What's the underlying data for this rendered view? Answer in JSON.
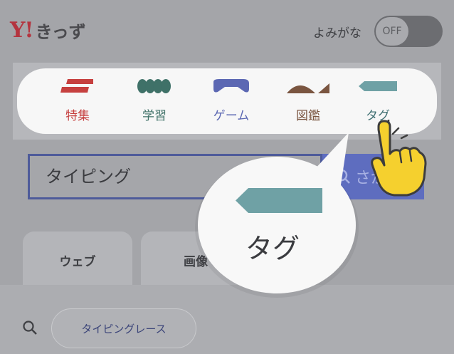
{
  "header": {
    "logo_mark": "Y!",
    "logo_text": "きっず",
    "yomigana_label": "よみがな",
    "yomigana_state": "OFF"
  },
  "menu": {
    "items": [
      {
        "label": "特集",
        "color": "#c6403f",
        "icon": "feature-stripes-icon"
      },
      {
        "label": "学習",
        "color": "#3f7168",
        "icon": "learning-beads-icon"
      },
      {
        "label": "ゲーム",
        "color": "#5c68b3",
        "icon": "game-controller-icon"
      },
      {
        "label": "図鑑",
        "color": "#7a5540",
        "icon": "encyclopedia-dome-icon"
      },
      {
        "label": "タグ",
        "color": "#3f6f72",
        "icon": "tag-icon"
      }
    ]
  },
  "search": {
    "query": "タイピング",
    "button_label": "さが"
  },
  "tabs": [
    {
      "label": "ウェブ"
    },
    {
      "label": "画像"
    }
  ],
  "suggestion": {
    "chip_label": "タイピングレース"
  },
  "callout": {
    "label": "タグ",
    "tag_color": "#6fa1a5"
  },
  "colors": {
    "accent": "#5e6dbf",
    "brand": "#b4343f"
  }
}
